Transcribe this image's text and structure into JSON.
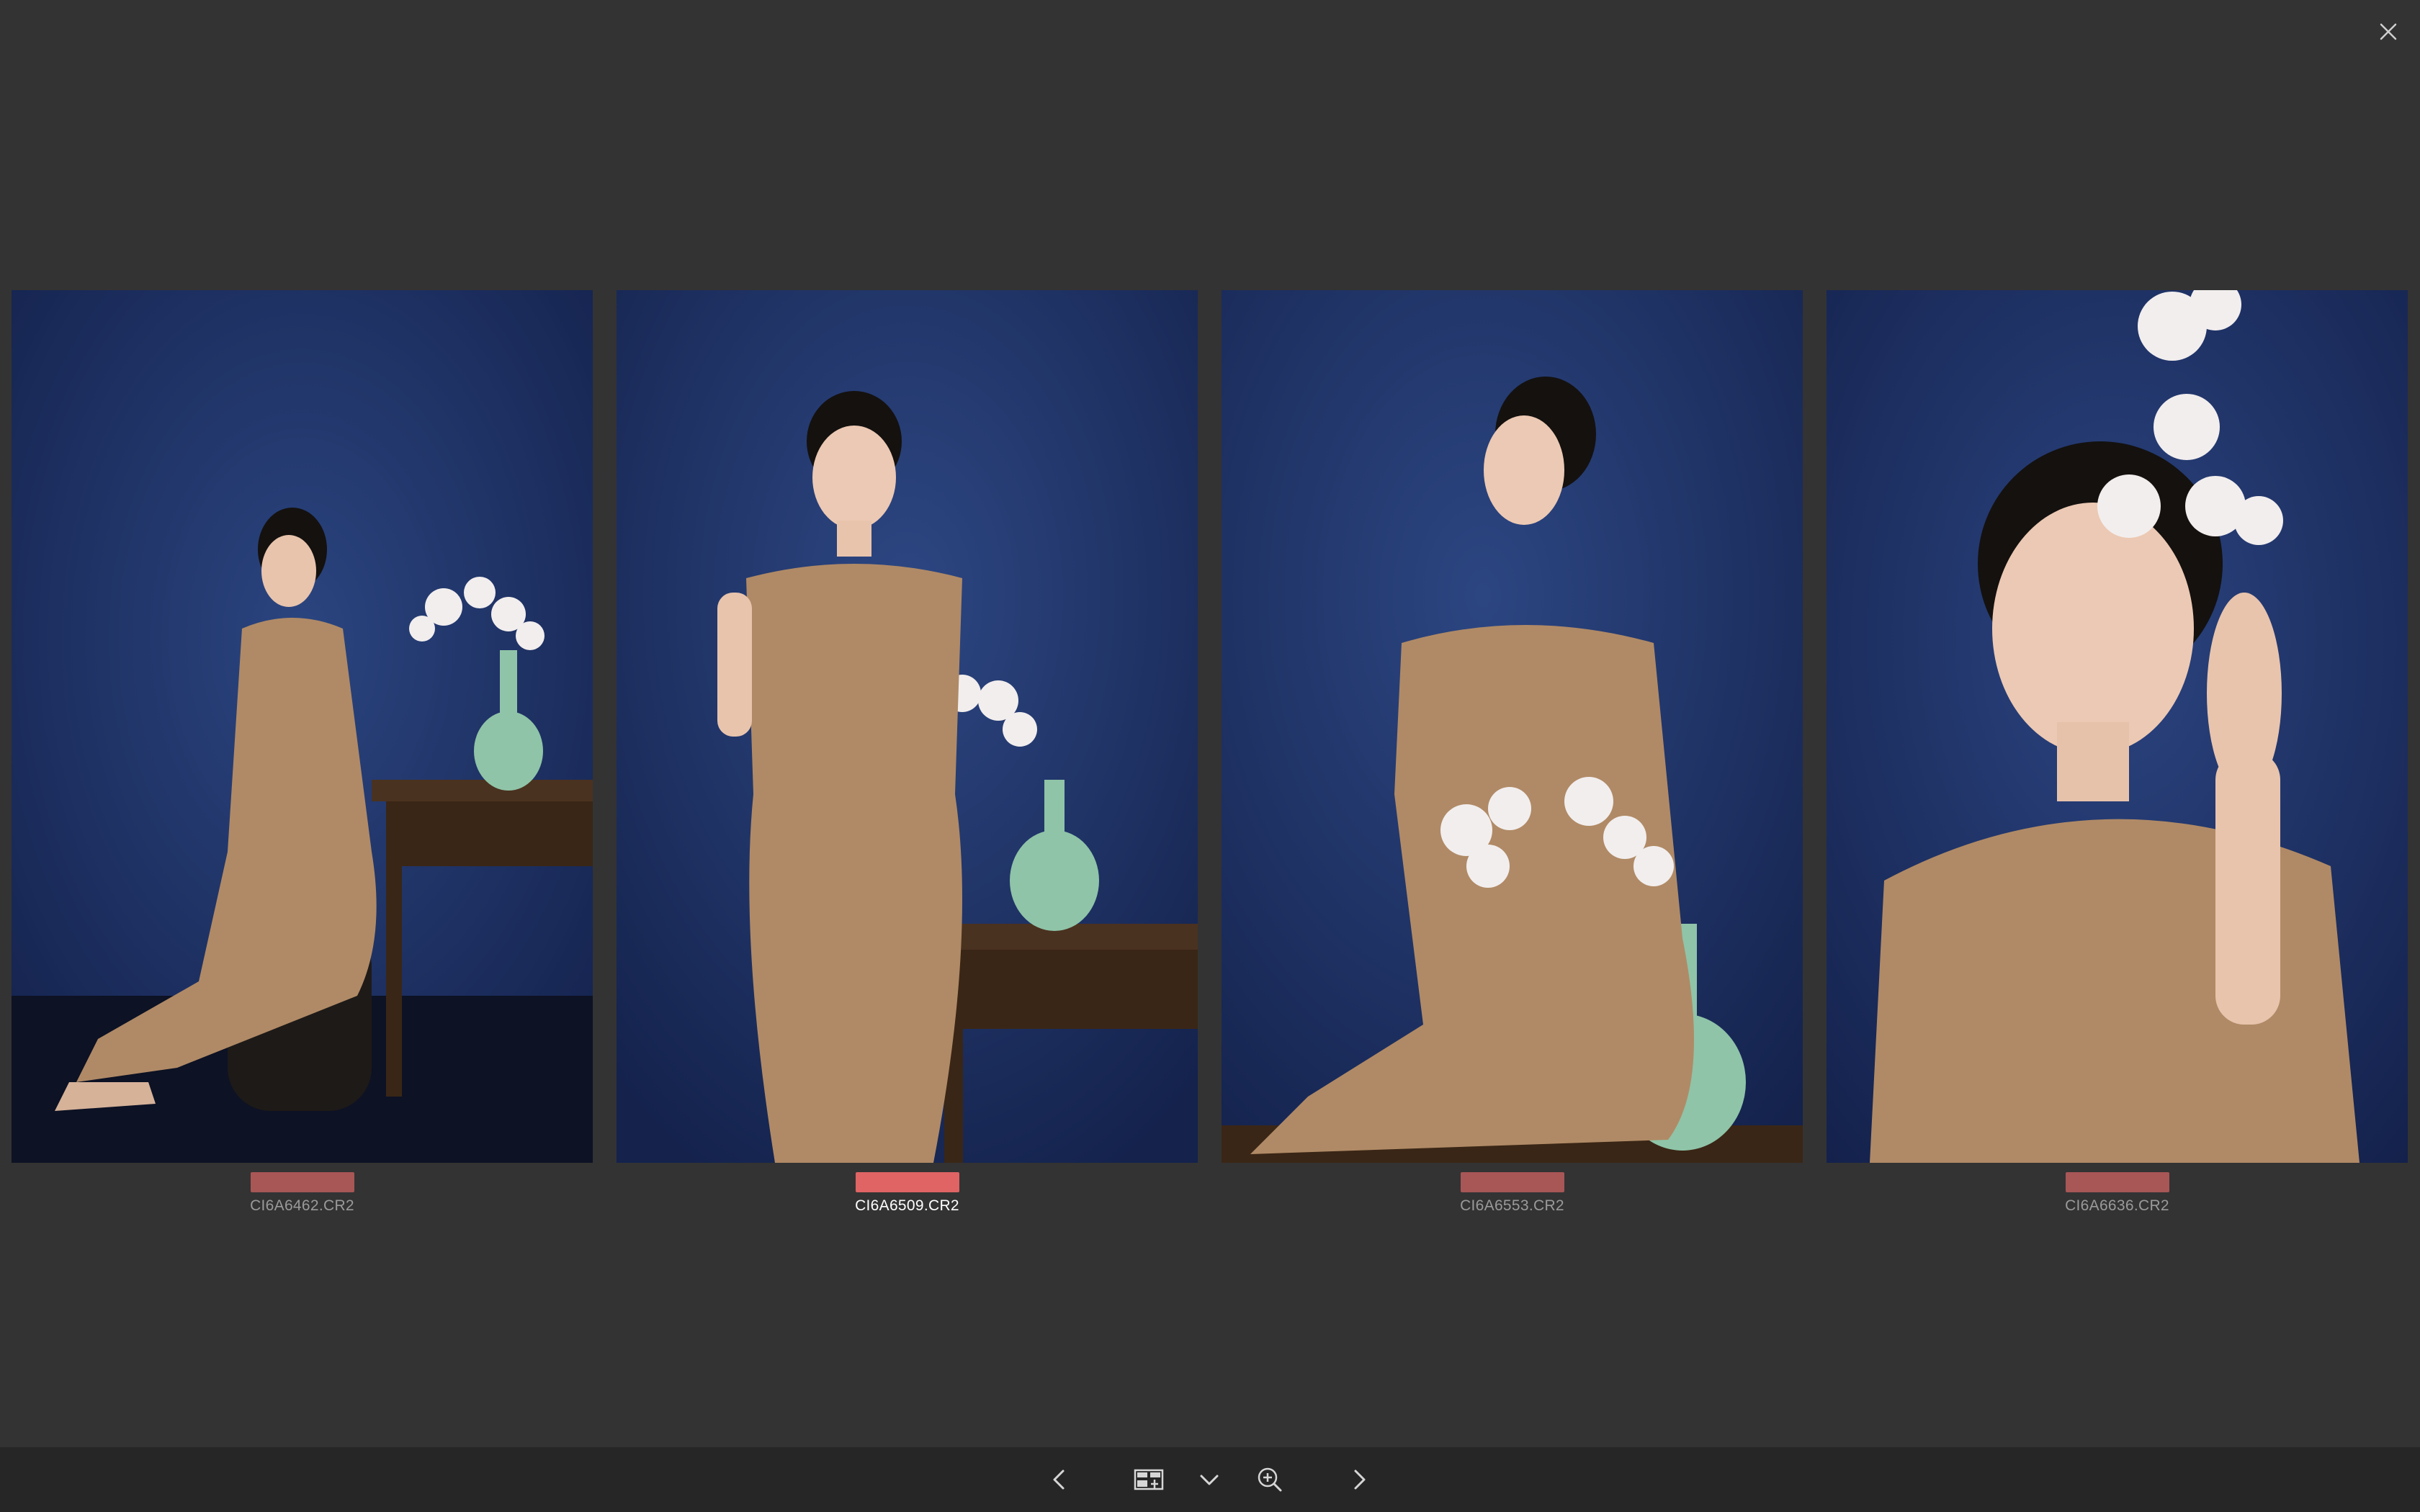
{
  "viewer": {
    "close_icon": "close-icon",
    "colors": {
      "background": "#333333",
      "toolbar": "#262626",
      "label_red_active": "#e06464",
      "label_red_dim": "#a85656",
      "filename_dim": "#9a9a9a",
      "filename_active": "#ffffff"
    }
  },
  "photos": [
    {
      "filename": "CI6A6462.CR2",
      "label_color": "#a85656",
      "selected": false
    },
    {
      "filename": "CI6A6509.CR2",
      "label_color": "#e06464",
      "selected": true
    },
    {
      "filename": "CI6A6553.CR2",
      "label_color": "#a85656",
      "selected": false
    },
    {
      "filename": "CI6A6636.CR2",
      "label_color": "#a85656",
      "selected": false
    }
  ],
  "toolbar": {
    "items": [
      {
        "name": "previous",
        "icon": "chevron-left-icon"
      },
      {
        "name": "compare-mode",
        "icon": "compare-grid-icon"
      },
      {
        "name": "options",
        "icon": "chevron-down-icon"
      },
      {
        "name": "zoom",
        "icon": "zoom-in-icon"
      },
      {
        "name": "next",
        "icon": "chevron-right-icon"
      }
    ]
  }
}
